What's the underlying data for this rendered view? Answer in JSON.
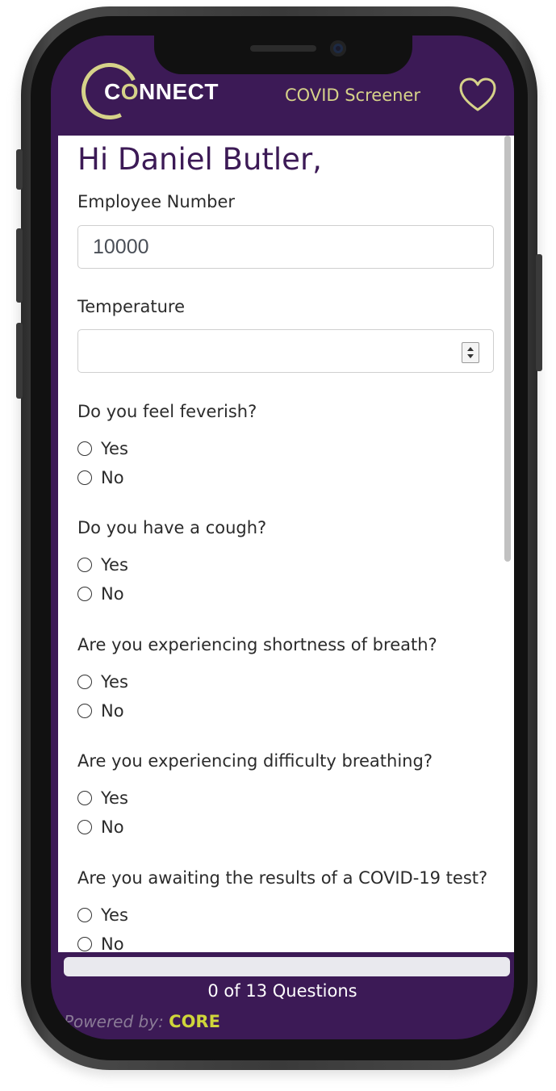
{
  "header": {
    "logo_text_pre": "C",
    "logo_text_dot": "O",
    "logo_text_post": "NNECT",
    "title": "COVID Screener",
    "favorite_icon": "heart-outline-icon"
  },
  "form": {
    "greeting": "Hi Daniel Butler,",
    "employee_number": {
      "label": "Employee Number",
      "value": "10000"
    },
    "temperature": {
      "label": "Temperature",
      "value": ""
    },
    "questions": [
      {
        "text": "Do you feel feverish?",
        "options": [
          "Yes",
          "No"
        ]
      },
      {
        "text": "Do you have a cough?",
        "options": [
          "Yes",
          "No"
        ]
      },
      {
        "text": "Are you experiencing shortness of breath?",
        "options": [
          "Yes",
          "No"
        ]
      },
      {
        "text": "Are you experiencing difficulty breathing?",
        "options": [
          "Yes",
          "No"
        ]
      },
      {
        "text": "Are you awaiting the results of a COVID-19 test?",
        "options": [
          "Yes",
          "No"
        ]
      }
    ]
  },
  "footer": {
    "progress": 0,
    "progress_text": "0 of 13 Questions",
    "powered_prefix": "Powered by:",
    "powered_brand": "CORE"
  },
  "colors": {
    "brand_purple": "#3c1a56",
    "accent_yellow": "#d6d289",
    "core_green": "#cfd63a"
  }
}
